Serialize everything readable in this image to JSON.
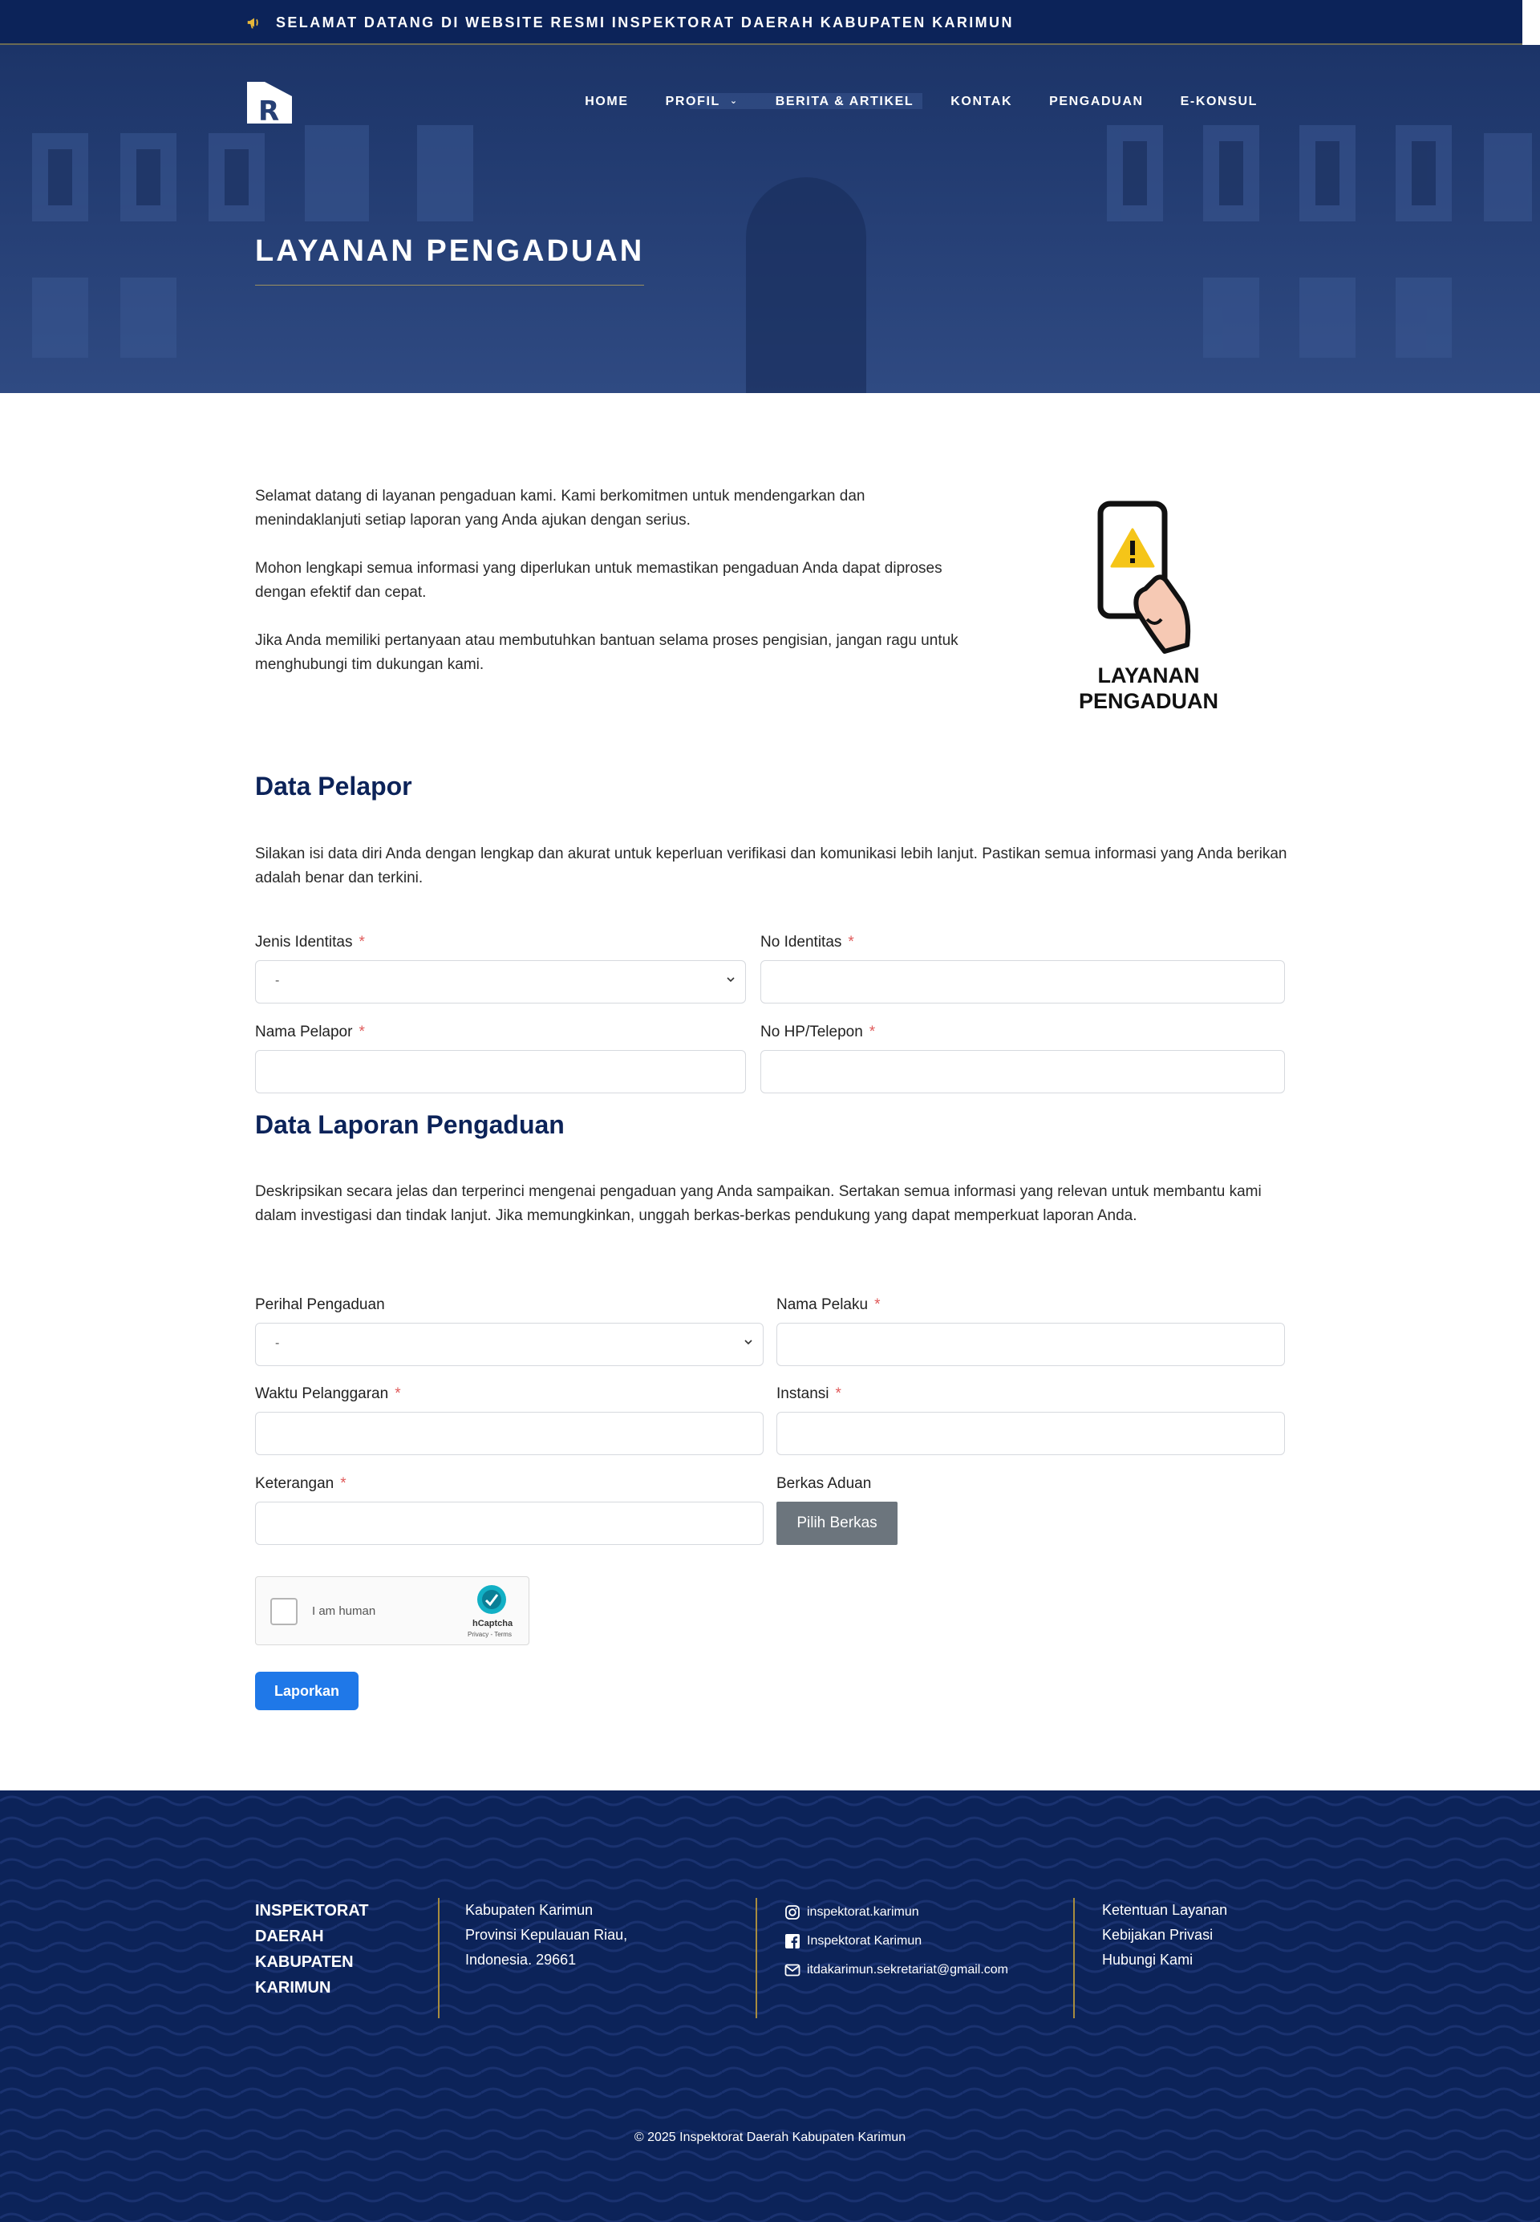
{
  "announcement": "SELAMAT DATANG DI WEBSITE RESMI INSPEKTORAT DAERAH KABUPATEN KARIMUN",
  "nav": [
    "HOME",
    "PROFIL",
    "BERITA & ARTIKEL",
    "KONTAK",
    "PENGADUAN",
    "E-KONSUL"
  ],
  "page_title": "LAYANAN PENGADUAN",
  "intro": [
    "Selamat datang di layanan pengaduan kami. Kami berkomitmen untuk mendengarkan dan menindaklanjuti setiap laporan yang Anda ajukan dengan serius.",
    "Mohon lengkapi semua informasi yang diperlukan untuk memastikan pengaduan Anda dapat diproses dengan efektif dan cepat.",
    "Jika Anda memiliki pertanyaan atau membutuhkan bantuan selama proses pengisian, jangan ragu untuk menghubungi tim dukungan kami."
  ],
  "illustration_label": [
    "LAYANAN",
    "PENGADUAN"
  ],
  "reporter": {
    "heading": "Data Pelapor",
    "desc": "Silakan isi data diri Anda dengan lengkap dan akurat untuk keperluan verifikasi dan komunikasi lebih lanjut. Pastikan semua informasi yang Anda berikan adalah benar dan terkini.",
    "id_type_label": "Jenis Identitas",
    "id_type_value": "-",
    "id_no_label": "No Identitas",
    "name_label": "Nama Pelapor",
    "phone_label": "No HP/Telepon",
    "required_mark": "*"
  },
  "report": {
    "heading": "Data Laporan Pengaduan",
    "desc": "Deskripsikan secara jelas dan terperinci mengenai pengaduan yang Anda sampaikan. Sertakan semua informasi yang relevan untuk membantu kami dalam investigasi dan tindak lanjut. Jika memungkinkan, unggah berkas-berkas pendukung yang dapat memperkuat laporan Anda.",
    "subject_label": "Perihal Pengaduan",
    "subject_value": "-",
    "perpetrator_label": "Nama Pelaku",
    "time_label": "Waktu Pelanggaran",
    "agency_label": "Instansi",
    "notes_label": "Keterangan",
    "files_label": "Berkas Aduan",
    "files_button": "Pilih Berkas"
  },
  "captcha": {
    "label": "I am human",
    "brand": "hCaptcha",
    "terms": "Privacy - Terms"
  },
  "submit_label": "Laporkan",
  "footer": {
    "org": [
      "INSPEKTORAT",
      "DAERAH",
      "KABUPATEN",
      "KARIMUN"
    ],
    "address": [
      "Kabupaten Karimun",
      "Provinsi Kepulauan Riau,",
      "Indonesia. 29661"
    ],
    "instagram": "inspektorat.karimun",
    "facebook": "Inspektorat Karimun",
    "email": "itdakarimun.sekretariat@gmail.com",
    "links": [
      "Ketentuan Layanan",
      "Kebijakan Privasi",
      "Hubungi Kami"
    ],
    "copyright": "© 2025 Inspektorat Daerah Kabupaten Karimun"
  },
  "colors": {
    "navy": "#0c2359",
    "gold": "#a78c3f",
    "accent": "#1f78e8",
    "required": "#e05a5a"
  }
}
